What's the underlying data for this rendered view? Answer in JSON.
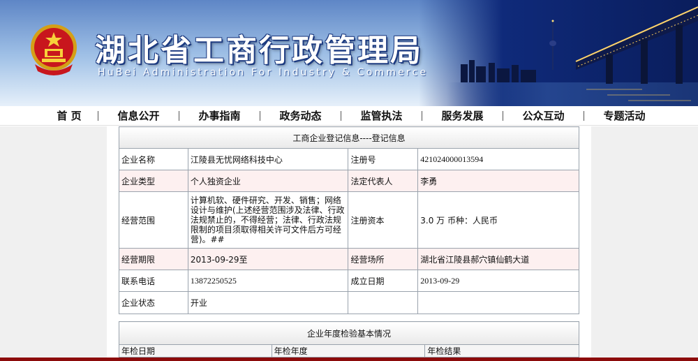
{
  "header": {
    "title_cn": "湖北省工商行政管理局",
    "title_en": "HuBei Administration For Industry & Commerce",
    "emblem_icon": "national-emblem-icon"
  },
  "nav": {
    "items": [
      {
        "label": "首 页"
      },
      {
        "label": "信息公开"
      },
      {
        "label": "办事指南"
      },
      {
        "label": "政务动态"
      },
      {
        "label": "监管执法"
      },
      {
        "label": "服务发展"
      },
      {
        "label": "公众互动"
      },
      {
        "label": "专题活动"
      }
    ]
  },
  "registration": {
    "caption": "工商企业登记信息----登记信息",
    "rows": [
      {
        "l1": "企业名称",
        "v1": "江陵县无忧网络科技中心",
        "l2": "注册号",
        "v2": "421024000013594"
      },
      {
        "l1": "企业类型",
        "v1": "个人独资企业",
        "l2": "法定代表人",
        "v2": "李勇"
      },
      {
        "l1": "经营范围",
        "v1": "计算机软、硬件研究、开发、销售；网络设计与维护(上述经营范围涉及法律、行政法规禁止的，不得经营；法律、行政法规限制的项目须取得相关许可文件后方可经营)。##",
        "l2": "注册资本",
        "v2": "3.0 万 币种：人民币"
      },
      {
        "l1": "经营期限",
        "v1": "2013-09-29至",
        "l2": "经营场所",
        "v2": "湖北省江陵县郝穴镇仙鹤大道"
      },
      {
        "l1": "联系电话",
        "v1": "13872250525",
        "l2": "成立日期",
        "v2": "2013-09-29"
      },
      {
        "l1": "企业状态",
        "v1": "开业",
        "l2": "",
        "v2": ""
      }
    ]
  },
  "annual": {
    "caption": "企业年度检验基本情况",
    "headers": [
      "年检日期",
      "年检年度",
      "年检结果"
    ]
  },
  "colors": {
    "banner_dark": "#0a1d5c",
    "banner_light": "#9fc0e6",
    "bottom_rule": "#8c0b0b",
    "pink_row": "#fdf0f0",
    "side_gray": "#f0f0f0"
  }
}
